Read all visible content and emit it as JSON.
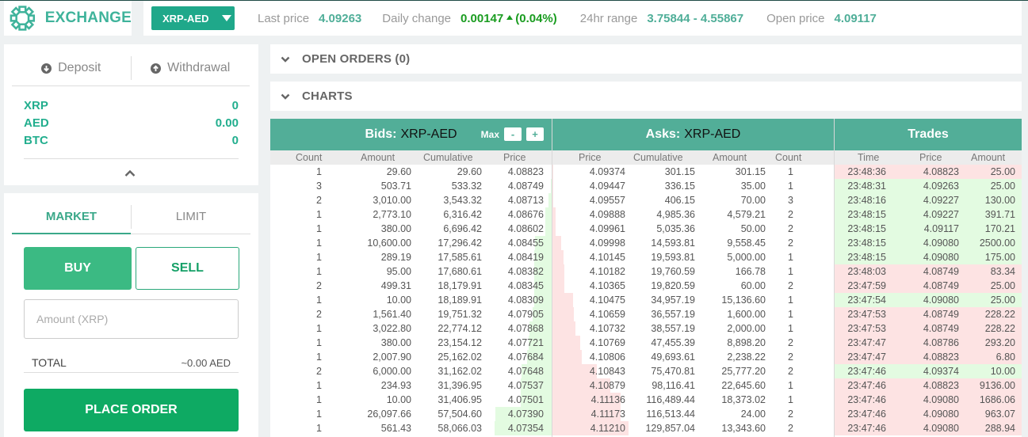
{
  "header": {
    "brand": "EXCHANGE",
    "pair_selector": "XRP-AED",
    "stats": {
      "last_price_label": "Last price",
      "last_price": "4.09263",
      "daily_change_label": "Daily change",
      "daily_change": "0.00147",
      "daily_change_pct": "(0.04%)",
      "range_label": "24hr range",
      "range": "3.75844 - 4.55867",
      "open_price_label": "Open price",
      "open_price": "4.09117"
    }
  },
  "wallet": {
    "deposit_label": "Deposit",
    "withdrawal_label": "Withdrawal",
    "balances": [
      {
        "currency": "XRP",
        "amount": "0"
      },
      {
        "currency": "AED",
        "amount": "0.00"
      },
      {
        "currency": "BTC",
        "amount": "0"
      }
    ]
  },
  "order_form": {
    "tabs": [
      {
        "label": "MARKET",
        "active": true
      },
      {
        "label": "LIMIT",
        "active": false
      }
    ],
    "buy_label": "BUY",
    "sell_label": "SELL",
    "amount_placeholder": "Amount (XRP)",
    "amount_value": "",
    "total_label": "TOTAL",
    "total_value": "~0.00 AED",
    "place_order_label": "PLACE ORDER"
  },
  "sections": {
    "open_orders": "OPEN ORDERS (0)",
    "charts": "CHARTS"
  },
  "bids": {
    "title_bold": "Bids:",
    "pair": "XRP-AED",
    "max_label": "Max",
    "minus_label": "-",
    "plus_label": "+",
    "columns": [
      "Count",
      "Amount",
      "Cumulative",
      "Price"
    ],
    "rows": [
      [
        "1",
        "29.60",
        "29.60",
        "4.08823"
      ],
      [
        "3",
        "503.71",
        "533.32",
        "4.08749"
      ],
      [
        "2",
        "3,010.00",
        "3,543.32",
        "4.08713"
      ],
      [
        "1",
        "2,773.10",
        "6,316.42",
        "4.08676"
      ],
      [
        "1",
        "380.00",
        "6,696.42",
        "4.08602"
      ],
      [
        "1",
        "10,600.00",
        "17,296.42",
        "4.08455"
      ],
      [
        "1",
        "289.19",
        "17,585.61",
        "4.08419"
      ],
      [
        "1",
        "95.00",
        "17,680.61",
        "4.08382"
      ],
      [
        "2",
        "499.31",
        "18,179.91",
        "4.08345"
      ],
      [
        "1",
        "10.00",
        "18,189.91",
        "4.08309"
      ],
      [
        "2",
        "1,561.40",
        "19,751.32",
        "4.07905"
      ],
      [
        "1",
        "3,022.80",
        "22,774.12",
        "4.07868"
      ],
      [
        "1",
        "380.00",
        "23,154.12",
        "4.07721"
      ],
      [
        "1",
        "2,007.90",
        "25,162.02",
        "4.07684"
      ],
      [
        "2",
        "6,000.00",
        "31,162.02",
        "4.07648"
      ],
      [
        "1",
        "234.93",
        "31,396.95",
        "4.07537"
      ],
      [
        "1",
        "10.00",
        "31,406.95",
        "4.07501"
      ],
      [
        "1",
        "26,097.66",
        "57,504.60",
        "4.07390"
      ],
      [
        "1",
        "561.43",
        "58,066.03",
        "4.07354"
      ]
    ]
  },
  "asks": {
    "title_bold": "Asks:",
    "pair": "XRP-AED",
    "columns": [
      "Price",
      "Cumulative",
      "Amount",
      "Count"
    ],
    "rows": [
      [
        "4.09374",
        "301.15",
        "301.15",
        "1"
      ],
      [
        "4.09447",
        "336.15",
        "35.00",
        "1"
      ],
      [
        "4.09557",
        "406.15",
        "70.00",
        "3"
      ],
      [
        "4.09888",
        "4,985.36",
        "4,579.21",
        "2"
      ],
      [
        "4.09961",
        "5,035.36",
        "50.00",
        "2"
      ],
      [
        "4.09998",
        "14,593.81",
        "9,558.45",
        "2"
      ],
      [
        "4.10145",
        "19,593.81",
        "5,000.00",
        "1"
      ],
      [
        "4.10182",
        "19,760.59",
        "166.78",
        "1"
      ],
      [
        "4.10365",
        "19,820.59",
        "60.00",
        "2"
      ],
      [
        "4.10475",
        "34,957.19",
        "15,136.60",
        "1"
      ],
      [
        "4.10659",
        "36,557.19",
        "1,600.00",
        "1"
      ],
      [
        "4.10732",
        "38,557.19",
        "2,000.00",
        "1"
      ],
      [
        "4.10769",
        "47,455.39",
        "8,898.20",
        "2"
      ],
      [
        "4.10806",
        "49,693.61",
        "2,238.22",
        "2"
      ],
      [
        "4.10843",
        "75,470.81",
        "25,777.20",
        "2"
      ],
      [
        "4.10879",
        "98,116.41",
        "22,645.60",
        "1"
      ],
      [
        "4.11136",
        "116,489.44",
        "18,373.02",
        "1"
      ],
      [
        "4.11173",
        "116,513.44",
        "24.00",
        "2"
      ],
      [
        "4.11210",
        "129,857.04",
        "13,343.60",
        "2"
      ]
    ]
  },
  "trades": {
    "title": "Trades",
    "columns": [
      "Time",
      "Price",
      "Amount"
    ],
    "rows": [
      {
        "time": "23:48:36",
        "price": "4.08823",
        "amount": "25.00",
        "side": "sell"
      },
      {
        "time": "23:48:31",
        "price": "4.09263",
        "amount": "25.00",
        "side": "buy"
      },
      {
        "time": "23:48:16",
        "price": "4.09227",
        "amount": "130.00",
        "side": "buy"
      },
      {
        "time": "23:48:15",
        "price": "4.09227",
        "amount": "391.71",
        "side": "buy"
      },
      {
        "time": "23:48:15",
        "price": "4.09117",
        "amount": "170.21",
        "side": "buy"
      },
      {
        "time": "23:48:15",
        "price": "4.09080",
        "amount": "2500.00",
        "side": "buy"
      },
      {
        "time": "23:48:15",
        "price": "4.09080",
        "amount": "175.00",
        "side": "buy"
      },
      {
        "time": "23:48:03",
        "price": "4.08749",
        "amount": "83.34",
        "side": "sell"
      },
      {
        "time": "23:47:59",
        "price": "4.08749",
        "amount": "25.00",
        "side": "sell"
      },
      {
        "time": "23:47:54",
        "price": "4.09080",
        "amount": "25.00",
        "side": "buy"
      },
      {
        "time": "23:47:53",
        "price": "4.08749",
        "amount": "228.22",
        "side": "sell"
      },
      {
        "time": "23:47:53",
        "price": "4.08749",
        "amount": "228.22",
        "side": "sell"
      },
      {
        "time": "23:47:47",
        "price": "4.08786",
        "amount": "293.20",
        "side": "sell"
      },
      {
        "time": "23:47:47",
        "price": "4.08823",
        "amount": "6.80",
        "side": "sell"
      },
      {
        "time": "23:47:46",
        "price": "4.09374",
        "amount": "10.00",
        "side": "buy"
      },
      {
        "time": "23:47:46",
        "price": "4.08823",
        "amount": "9136.00",
        "side": "sell"
      },
      {
        "time": "23:47:46",
        "price": "4.09080",
        "amount": "1686.06",
        "side": "sell"
      },
      {
        "time": "23:47:46",
        "price": "4.09080",
        "amount": "963.07",
        "side": "sell"
      },
      {
        "time": "23:47:46",
        "price": "4.09080",
        "amount": "288.94",
        "side": "sell"
      }
    ]
  },
  "colors": {
    "brand": "#3fb39b",
    "header_green": "#52ae98",
    "buy": "#3bba83",
    "place_order": "#0eaa63",
    "positive_change": "#1a9c20",
    "bid_depth": "#e3fbe1",
    "ask_depth": "#fde3e3"
  }
}
